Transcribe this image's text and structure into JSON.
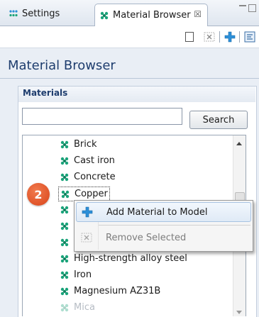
{
  "tabs": [
    {
      "label": "Settings",
      "icon": "settings-icon",
      "active": false
    },
    {
      "label": "Material Browser",
      "icon": "material-icon",
      "active": true,
      "close_glyph": "☒"
    }
  ],
  "page_title": "Material Browser",
  "section": {
    "title": "Materials"
  },
  "search": {
    "value": "",
    "button_label": "Search"
  },
  "materials": [
    {
      "label": "Brick"
    },
    {
      "label": "Cast iron"
    },
    {
      "label": "Concrete"
    },
    {
      "label": "Copper",
      "selected": true
    },
    {
      "label": "High-strength alloy steel"
    },
    {
      "label": "Iron"
    },
    {
      "label": "Magnesium AZ31B"
    },
    {
      "label": "Mica",
      "faded": true
    }
  ],
  "step_badge": "2",
  "context_menu": [
    {
      "label": "Add Material to Model",
      "icon": "add-plus-icon",
      "enabled": true
    },
    {
      "label": "Remove Selected",
      "icon": "remove-icon",
      "enabled": false
    }
  ],
  "colors": {
    "accent": "#1e3d6e",
    "badge": "#e2582a",
    "material_icon": "#1aa37a",
    "add_icon": "#2d8fd8"
  }
}
